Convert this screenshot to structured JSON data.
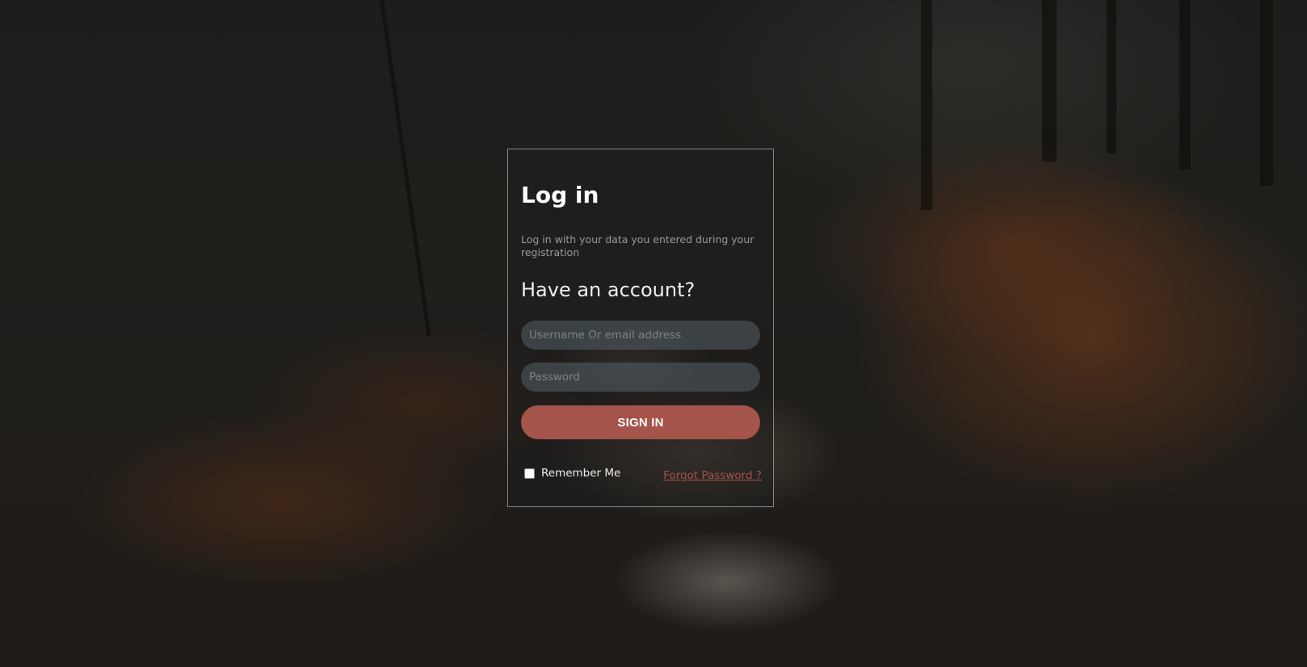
{
  "login": {
    "title": "Log in",
    "subtitle": "Log in with your data you entered during your registration",
    "question": "Have an account?",
    "username_placeholder": "Username Or email address",
    "password_placeholder": "Password",
    "signin_label": "SIGN IN",
    "remember_label": "Remember Me",
    "remember_checked": false,
    "forgot_label": "Forgot Password ?"
  },
  "colors": {
    "accent": "#a4544a",
    "input_bg": "#5f6e78",
    "background": "#1f1e1c"
  },
  "background": {
    "icon": "forest-stream-photo"
  }
}
